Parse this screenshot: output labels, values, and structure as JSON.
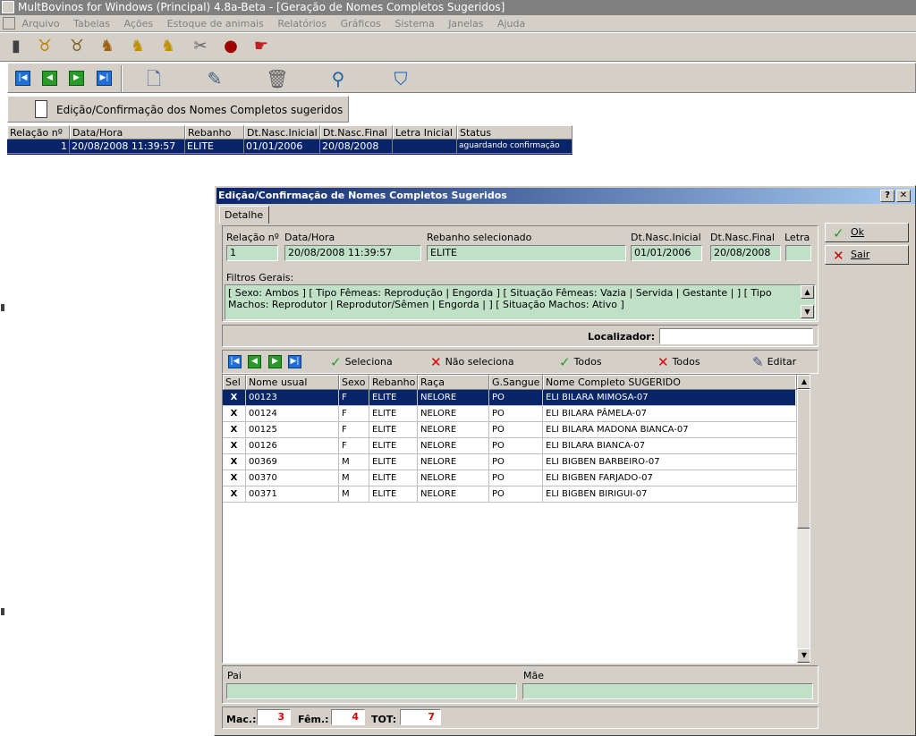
{
  "window": {
    "title": "MultBovinos for Windows (Principal) 4.8a-Beta - [Geração de Nomes Completos Sugeridos]"
  },
  "menu": [
    "Arquivo",
    "Tabelas",
    "Ações",
    "Estoque de animais",
    "Relatórios",
    "Gráficos",
    "Sistema",
    "Janelas",
    "Ajuda"
  ],
  "toolbar1": {
    "icons": [
      "book-icon",
      "cow-head-icon",
      "bull-icon",
      "cattle-icon",
      "calf-icon",
      "herd-icon",
      "tools-icon",
      "bomb-icon",
      "pointer-icon"
    ]
  },
  "toolbar2": {
    "icons": [
      "nav-first-icon",
      "nav-prev-icon",
      "nav-next-icon",
      "nav-last-icon",
      "new-document-icon",
      "edit-icon",
      "trash-icon",
      "search-icon",
      "confirm-shield-icon"
    ]
  },
  "header_button": {
    "label": "Edição/Confirmação dos Nomes Completos sugeridos"
  },
  "main_grid": {
    "columns": [
      "Relação nº",
      "Data/Hora",
      "Rebanho",
      "Dt.Nasc.Inicial",
      "Dt.Nasc.Final",
      "Letra Inicial",
      "Status"
    ],
    "rows": [
      {
        "relacao": "1",
        "datahora": "20/08/2008 11:39:57",
        "rebanho": "ELITE",
        "inicial": "01/01/2006",
        "final": "20/08/2008",
        "letra": "",
        "status": "aguardando confirmação"
      }
    ]
  },
  "dialog": {
    "title": "Edição/Confirmação de Nomes Completos Sugeridos",
    "help_btn": "?",
    "close_btn": "✕",
    "tab": "Detalhe",
    "labels": {
      "relacao": "Relação nº",
      "datahora": "Data/Hora",
      "rebanho": "Rebanho selecionado",
      "inicial": "Dt.Nasc.Inicial",
      "final": "Dt.Nasc.Final",
      "letra": "Letra",
      "filtros": "Filtros Gerais:",
      "localizador": "Localizador:",
      "pai": "Pai",
      "mae": "Mãe",
      "mac": "Mac.:",
      "fem": "Fêm.:",
      "tot": "TOT:"
    },
    "values": {
      "relacao": "1",
      "datahora": "20/08/2008 11:39:57",
      "rebanho": "ELITE",
      "inicial": "01/01/2006",
      "final": "20/08/2008",
      "letra": "",
      "filtros": "[ Sexo: Ambos ] [ Tipo Fêmeas: Reprodução | Engorda ] [ Situação Fêmeas: Vazia | Servida | Gestante | ] [ Tipo Machos: Reprodutor | Reprodutor/Sêmen | Engorda | ] [ Situação Machos: Ativo ]",
      "localizador": "",
      "pai": "",
      "mae": "",
      "mac": "3",
      "fem": "4",
      "tot": "7"
    },
    "buttons": {
      "ok": "Ok",
      "sair": "Sair"
    },
    "actions": {
      "seleciona": "Seleciona",
      "nao_seleciona": "Não seleciona",
      "todos_check": "Todos",
      "todos_x": "Todos",
      "editar": "Editar"
    },
    "grid": {
      "columns": [
        "Sel",
        "Nome usual",
        "Sexo",
        "Rebanho",
        "Raça",
        "G.Sangue",
        "Nome Completo SUGERIDO"
      ],
      "rows": [
        {
          "sel": "X",
          "nome": "00123",
          "sexo": "F",
          "rebanho": "ELITE",
          "raca": "NELORE",
          "sangue": "PO",
          "sugerido": "ELI BILARA MIMOSA-07"
        },
        {
          "sel": "X",
          "nome": "00124",
          "sexo": "F",
          "rebanho": "ELITE",
          "raca": "NELORE",
          "sangue": "PO",
          "sugerido": "ELI BILARA PÂMELA-07"
        },
        {
          "sel": "X",
          "nome": "00125",
          "sexo": "F",
          "rebanho": "ELITE",
          "raca": "NELORE",
          "sangue": "PO",
          "sugerido": "ELI BILARA MADONA BIANCA-07"
        },
        {
          "sel": "X",
          "nome": "00126",
          "sexo": "F",
          "rebanho": "ELITE",
          "raca": "NELORE",
          "sangue": "PO",
          "sugerido": "ELI BILARA BIANCA-07"
        },
        {
          "sel": "X",
          "nome": "00369",
          "sexo": "M",
          "rebanho": "ELITE",
          "raca": "NELORE",
          "sangue": "PO",
          "sugerido": "ELI BIGBEN BARBEIRO-07"
        },
        {
          "sel": "X",
          "nome": "00370",
          "sexo": "M",
          "rebanho": "ELITE",
          "raca": "NELORE",
          "sangue": "PO",
          "sugerido": "ELI BIGBEN FARJADO-07"
        },
        {
          "sel": "X",
          "nome": "00371",
          "sexo": "M",
          "rebanho": "ELITE",
          "raca": "NELORE",
          "sangue": "PO",
          "sugerido": "ELI BIGBEN BIRIGUI-07"
        }
      ]
    }
  },
  "colors": {
    "selection": "#0a246a",
    "field_green": "#c0e0c8",
    "count_red": "#e00000",
    "face": "#d4d0c8"
  }
}
